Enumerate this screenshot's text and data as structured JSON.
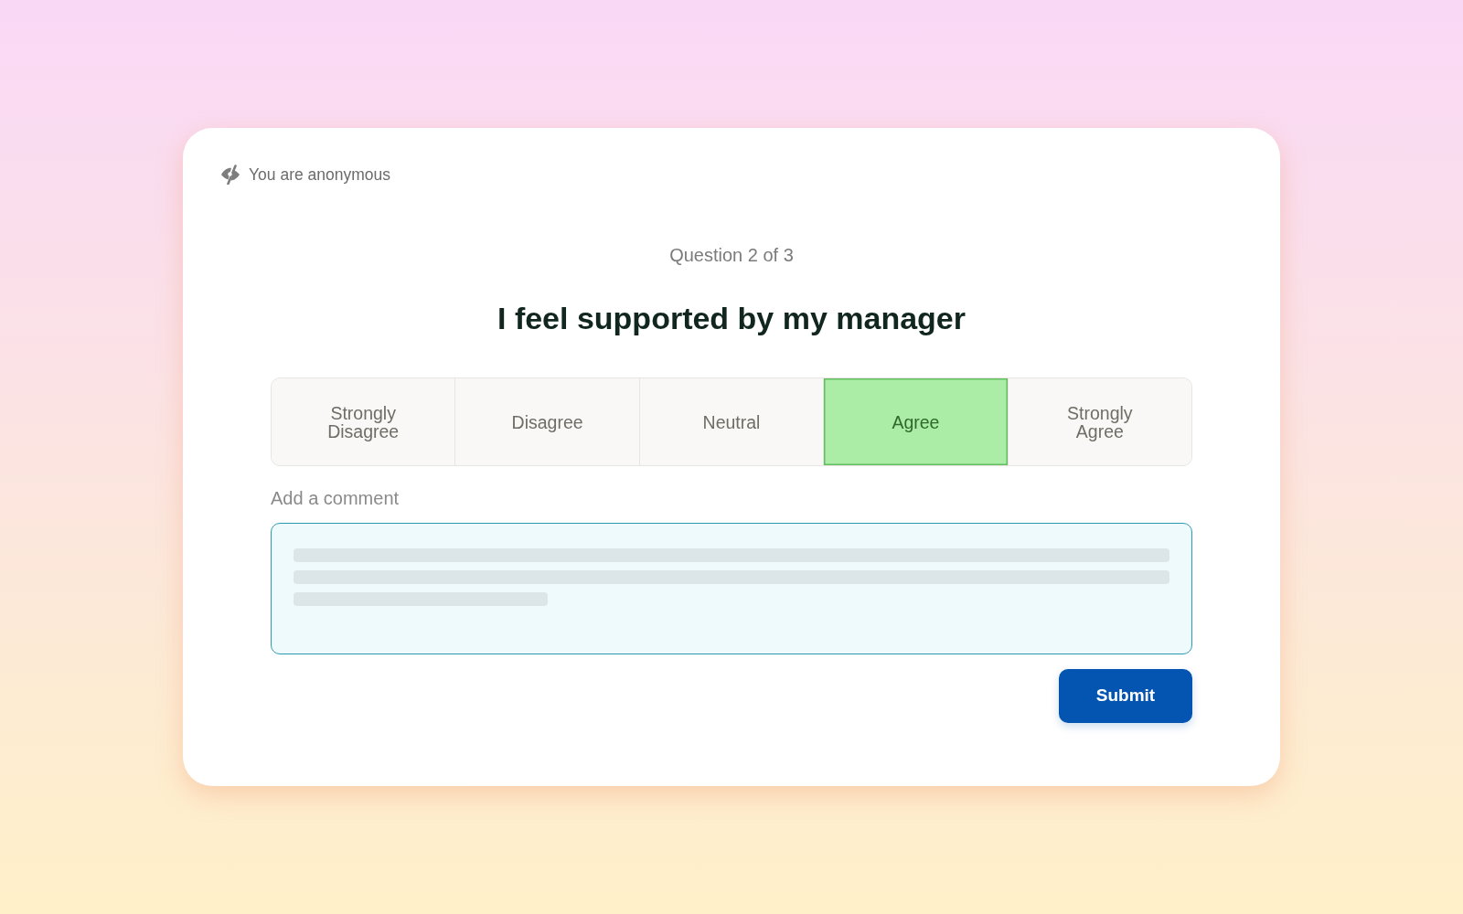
{
  "header": {
    "anonymity_notice": "You are anonymous"
  },
  "question": {
    "counter": "Question 2 of 3",
    "text": "I feel supported by my manager"
  },
  "options": [
    {
      "label": "Strongly Disagree",
      "selected": false
    },
    {
      "label": "Disagree",
      "selected": false
    },
    {
      "label": "Neutral",
      "selected": false
    },
    {
      "label": "Agree",
      "selected": true
    },
    {
      "label": "Strongly Agree",
      "selected": false
    }
  ],
  "comment": {
    "label": "Add a comment"
  },
  "submit_button": "Submit"
}
